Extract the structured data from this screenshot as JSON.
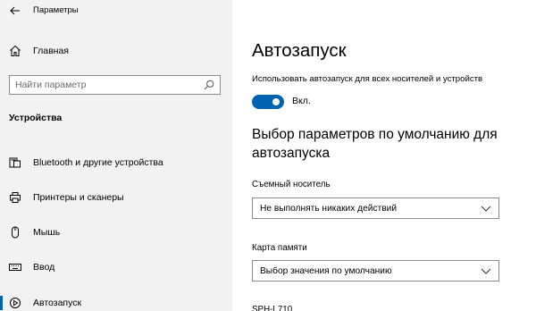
{
  "window": {
    "title": "Параметры"
  },
  "nav": {
    "home_label": "Главная",
    "search": {
      "placeholder": "Найти параметр",
      "value": ""
    },
    "section_title": "Устройства",
    "items": [
      {
        "label": "Bluetooth и другие устройства",
        "icon": "bluetooth-devices-icon",
        "selected": false
      },
      {
        "label": "Принтеры и сканеры",
        "icon": "printer-icon",
        "selected": false
      },
      {
        "label": "Мышь",
        "icon": "mouse-icon",
        "selected": false
      },
      {
        "label": "Ввод",
        "icon": "keyboard-icon",
        "selected": false
      },
      {
        "label": "Автозапуск",
        "icon": "autoplay-icon",
        "selected": true
      }
    ]
  },
  "main": {
    "title": "Автозапуск",
    "toggle": {
      "description": "Использовать автозапуск для всех носителей и устройств",
      "state_label": "Вкл.",
      "on": true
    },
    "defaults_heading": "Выбор параметров по умолчанию для автозапуска",
    "removable": {
      "label": "Съемный носитель",
      "selected": "Не выполнять никаких действий"
    },
    "memory_card": {
      "label": "Карта памяти",
      "selected": "Выбор значения по умолчанию"
    },
    "device_label": "SPH-L710"
  },
  "colors": {
    "accent": "#0063b1",
    "nav_background": "#f2f2f2",
    "content_background": "#ffffff",
    "border": "#8a8a8a"
  }
}
